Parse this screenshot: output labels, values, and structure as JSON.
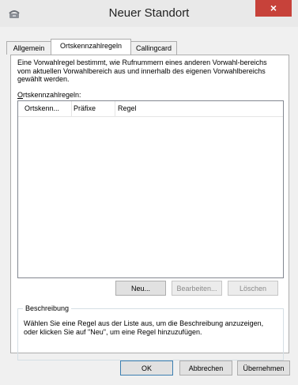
{
  "window": {
    "title": "Neuer Standort",
    "close_symbol": "×"
  },
  "tabs": [
    {
      "label": "Allgemein"
    },
    {
      "label": "Ortskennzahlregeln"
    },
    {
      "label": "Callingcard"
    }
  ],
  "active_tab": "Ortskennzahlregeln",
  "panel": {
    "description": "Eine Vorwahlregel bestimmt, wie Rufnummern eines anderen Vorwahl-bereichs vom aktuellen Vorwahlbereich aus und innerhalb des eigenen Vorwahlbereichs gewählt werden.",
    "list_label": "Ortskennzahlregeln:",
    "columns": [
      "Ortskenn...",
      "Präfixe",
      "Regel"
    ],
    "rows": [],
    "buttons": {
      "new": "Neu...",
      "edit": "Bearbeiten...",
      "delete": "Löschen"
    },
    "group": {
      "legend": "Beschreibung",
      "text": "Wählen Sie eine Regel aus der Liste aus, um die Beschreibung anzuzeigen, oder klicken Sie auf \"Neu\", um eine Regel hinzuzufügen."
    }
  },
  "footer": {
    "ok": "OK",
    "cancel": "Abbrechen",
    "apply": "Übernehmen"
  },
  "icons": {
    "title_icon": "phone-icon",
    "close_icon": "close-icon"
  },
  "colors": {
    "close_button": "#c7423a",
    "titlebar": "#e9e9e9",
    "dialog_bg": "#f0f0f0",
    "default_button_border": "#3c7fb1"
  }
}
